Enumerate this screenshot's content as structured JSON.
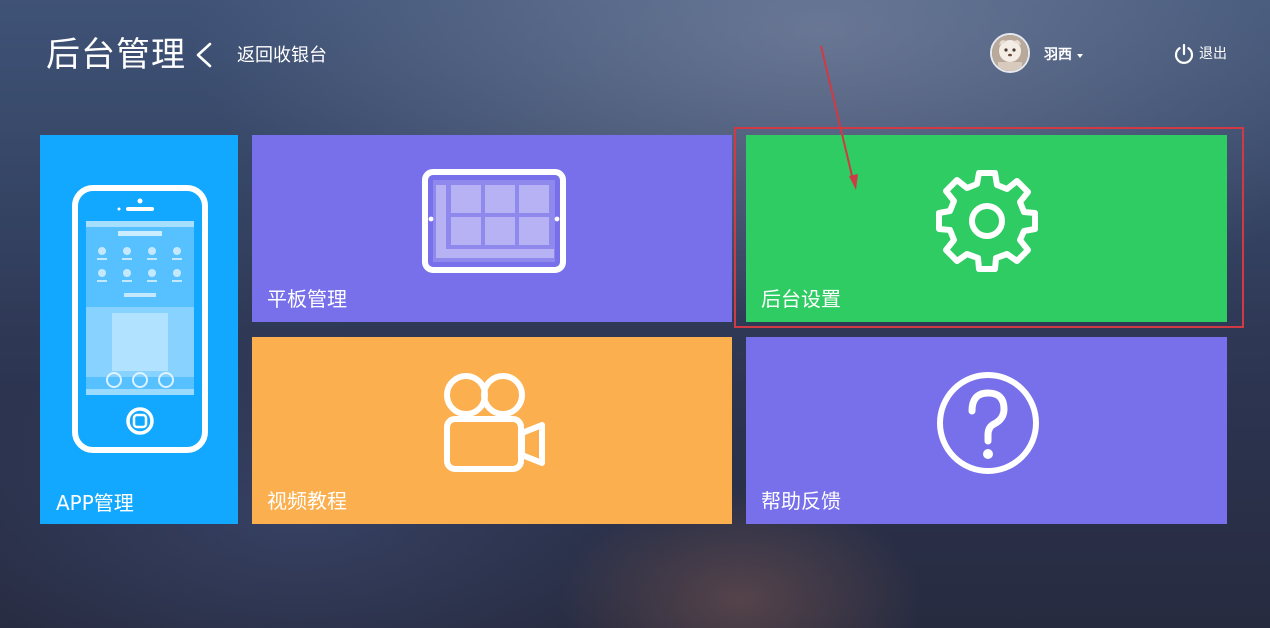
{
  "header": {
    "title": "后台管理",
    "back_label": "返回收银台",
    "user_name": "羽西",
    "logout_label": "退出"
  },
  "tiles": {
    "app": {
      "label": "APP管理",
      "color": "#12a8ff",
      "icon": "phone-icon"
    },
    "tablet": {
      "label": "平板管理",
      "color": "#7770ea",
      "icon": "tablet-icon"
    },
    "settings": {
      "label": "后台设置",
      "color": "#2ecc62",
      "icon": "gear-icon"
    },
    "video": {
      "label": "视频教程",
      "color": "#fcaf4f",
      "icon": "video-camera-icon"
    },
    "help": {
      "label": "帮助反馈",
      "color": "#7770ea",
      "icon": "question-icon"
    }
  },
  "annotation": {
    "highlight_color": "#d03a44",
    "target": "settings"
  }
}
